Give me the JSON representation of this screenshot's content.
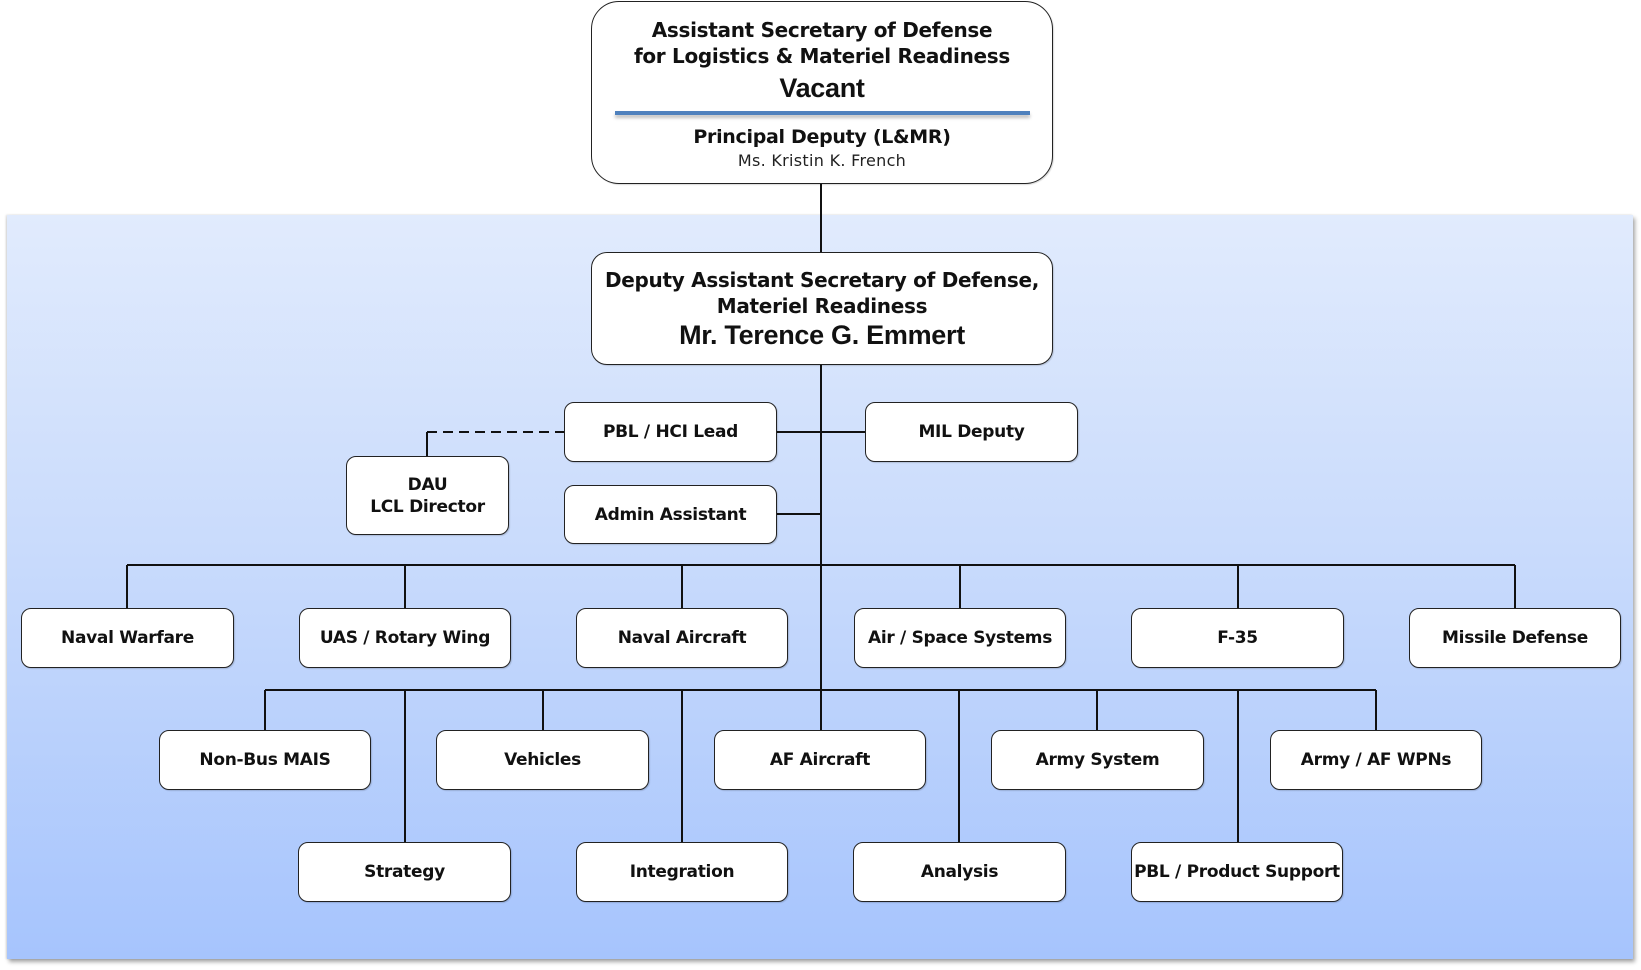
{
  "top_office": {
    "title_line1": "Assistant Secretary of Defense",
    "title_line2": "for Logistics & Materiel Readiness",
    "name": "Vacant",
    "deputy_title": "Principal Deputy (L&MR)",
    "deputy_name": "Ms. Kristin K. French"
  },
  "dasd": {
    "title_line1": "Deputy Assistant Secretary of Defense,",
    "title_line2": "Materiel Readiness",
    "name": "Mr. Terence G. Emmert"
  },
  "staff": {
    "pbl_hci_lead": "PBL / HCI Lead",
    "mil_deputy": "MIL Deputy",
    "admin_assistant": "Admin Assistant",
    "dau_line1": "DAU",
    "dau_line2": "LCL Director"
  },
  "row1": [
    {
      "label": "Naval Warfare"
    },
    {
      "label": "UAS / Rotary Wing"
    },
    {
      "label": "Naval Aircraft"
    },
    {
      "label": "Air / Space Systems"
    },
    {
      "label": "F-35"
    },
    {
      "label": "Missile Defense"
    }
  ],
  "row2": [
    {
      "label": "Non-Bus MAIS"
    },
    {
      "label": "Vehicles"
    },
    {
      "label": "AF Aircraft"
    },
    {
      "label": "Army System"
    },
    {
      "label": "Army / AF WPNs"
    }
  ],
  "row3": [
    {
      "label": "Strategy"
    },
    {
      "label": "Integration"
    },
    {
      "label": "Analysis"
    },
    {
      "label": "PBL / Product Support"
    }
  ],
  "colors": {
    "divider": "#4f81bd",
    "panel_top": "#e1ebfd",
    "panel_bottom": "#a6c4fd",
    "line": "#111111"
  }
}
